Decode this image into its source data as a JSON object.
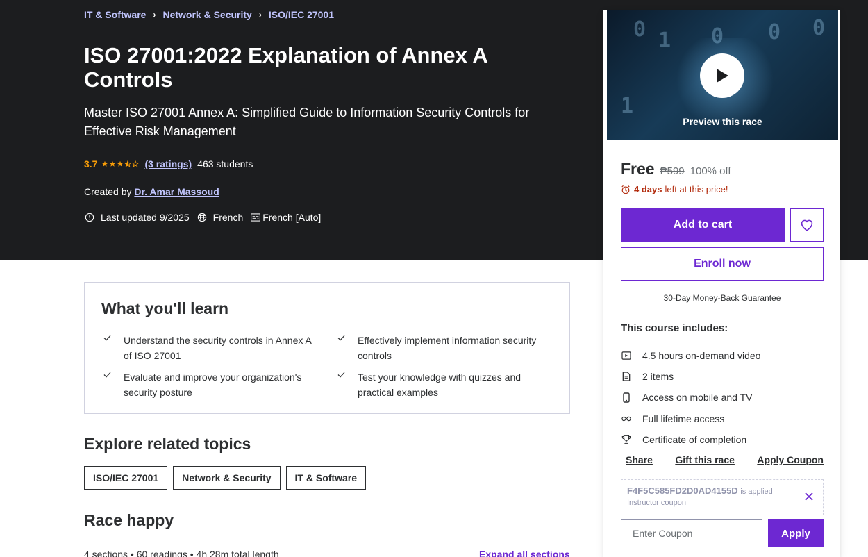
{
  "breadcrumb": {
    "items": [
      "IT & Software",
      "Network & Security",
      "ISO/IEC 27001"
    ],
    "separator": "›"
  },
  "course": {
    "title": "ISO 27001:2022 Explanation of Annex A Controls",
    "subtitle": "Master ISO 27001 Annex A: Simplified Guide to Information Security Controls for Effective Risk Management",
    "rating_value": "3.7",
    "rating_stars": 3.5,
    "ratings_link": "(3 ratings)",
    "students": "463 students",
    "created_by_label": "Created by",
    "instructor": "Dr. Amar Massoud",
    "last_updated": "Last updated 9/2025",
    "language": "French",
    "captions": "French [Auto]"
  },
  "sidebar": {
    "preview_label": "Preview this race",
    "price_now": "Free",
    "price_old": "₱599",
    "discount": "100% off",
    "timer_bold": "4 days",
    "timer_rest": "left at this price!",
    "add_to_cart": "Add to cart",
    "enroll_now": "Enroll now",
    "guarantee": "30-Day Money-Back Guarantee",
    "includes_title": "This course includes:",
    "includes": [
      {
        "icon": "video-icon",
        "label": "4.5 hours on-demand video"
      },
      {
        "icon": "file-icon",
        "label": "2 items"
      },
      {
        "icon": "mobile-icon",
        "label": "Access on mobile and TV"
      },
      {
        "icon": "infinity-icon",
        "label": "Full lifetime access"
      },
      {
        "icon": "trophy-icon",
        "label": "Certificate of completion"
      }
    ],
    "links": [
      "Share",
      "Gift this race",
      "Apply Coupon"
    ],
    "coupon_code": "F4F5C585FD2D0AD4155D",
    "coupon_applied": "is applied",
    "coupon_sub": "Instructor coupon",
    "coupon_placeholder": "Enter Coupon",
    "apply_label": "Apply"
  },
  "learn": {
    "title": "What you'll learn",
    "items": [
      "Understand the security controls in Annex A of ISO 27001",
      "Effectively implement information security controls",
      "Evaluate and improve your organization's security posture",
      "Test your knowledge with quizzes and practical examples"
    ]
  },
  "explore": {
    "title": "Explore related topics",
    "topics": [
      "ISO/IEC 27001",
      "Network & Security",
      "IT & Software"
    ]
  },
  "race": {
    "title": "Race happy",
    "meta": "4 sections • 60 readings • 4h 28m total length",
    "expand": "Expand all sections"
  },
  "colors": {
    "hero_bg": "#1c1d1f",
    "accent": "#6d28d2",
    "link_light": "#c0c4fc",
    "star": "#f69c08",
    "timer": "#b32d0f"
  }
}
